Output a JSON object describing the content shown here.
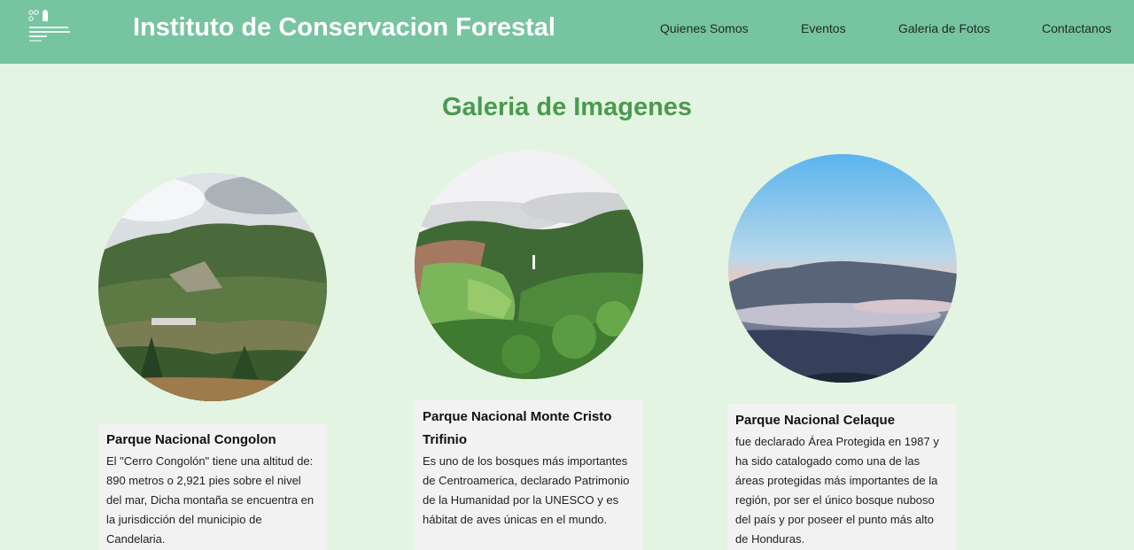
{
  "header": {
    "site_title": "Instituto de Conservacion Forestal",
    "nav": [
      {
        "label": "Quienes Somos"
      },
      {
        "label": "Eventos"
      },
      {
        "label": "Galeria de Fotos"
      },
      {
        "label": "Contactanos"
      }
    ]
  },
  "main": {
    "heading": "Galeria de Imagenes"
  },
  "gallery": [
    {
      "title": "Parque Nacional Congolon",
      "text": "El \"Cerro Congolón\" tiene una altitud de: 890 metros o 2,921 pies sobre el nivel del mar, Dicha montaña se encuentra en la jurisdicción del municipio de Candelaria."
    },
    {
      "title": "Parque Nacional Monte Cristo Trifinio",
      "text": "Es uno de los bosques más importantes de Centroamerica, declarado Patrimonio de la Humanidad por la UNESCO y es hábitat de aves únicas en el mundo."
    },
    {
      "title": "Parque Nacional Celaque",
      "text": "fue declarado Área Protegida en 1987 y ha sido catalogado como una de las áreas protegidas más importantes de la región, por ser el único bosque nuboso del país y por poseer el punto más alto de Honduras."
    }
  ],
  "colors": {
    "header_bg": "#77c4a0",
    "page_bg": "#e4f4e3",
    "heading": "#4a9a4e",
    "card_bg": "#f1f2f1"
  }
}
